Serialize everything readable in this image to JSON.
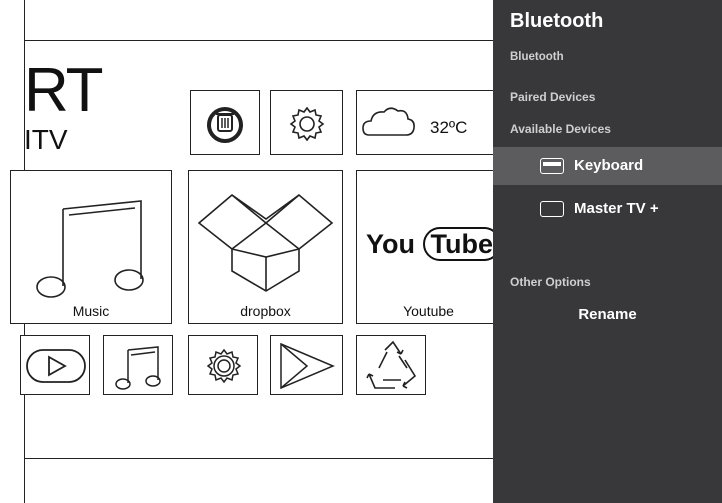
{
  "home": {
    "brand_big": "RT",
    "brand_small": "ITV",
    "weather": {
      "temperature": "32ºC",
      "icon": "cloud-icon"
    },
    "tiles": {
      "music": "Music",
      "dropbox": "dropbox",
      "youtube": "Youtube"
    },
    "youtube_logo": {
      "you": "You",
      "tube": "Tube"
    },
    "icons": [
      "cleaner-icon",
      "settings-gear-icon",
      "cloud-icon",
      "music-notes-icon",
      "dropbox-icon",
      "youtube-logo-icon",
      "play-circle-icon",
      "music-notes-small-icon",
      "settings-gear-small-icon",
      "play-store-icon",
      "recycle-icon"
    ]
  },
  "bluetooth_panel": {
    "title": "Bluetooth",
    "subtitle": "Bluetooth",
    "paired_devices": "Paired Devices",
    "available_devices": "Available Devices",
    "devices": [
      {
        "label": "Keyboard",
        "icon": "keyboard-icon",
        "selected": true
      },
      {
        "label": "Master TV +",
        "icon": "tv-icon",
        "selected": false
      }
    ],
    "other_options": "Other Options",
    "rename": "Rename",
    "colors": {
      "panel_bg": "#38383a",
      "selected_bg": "#5c5c5e"
    }
  }
}
